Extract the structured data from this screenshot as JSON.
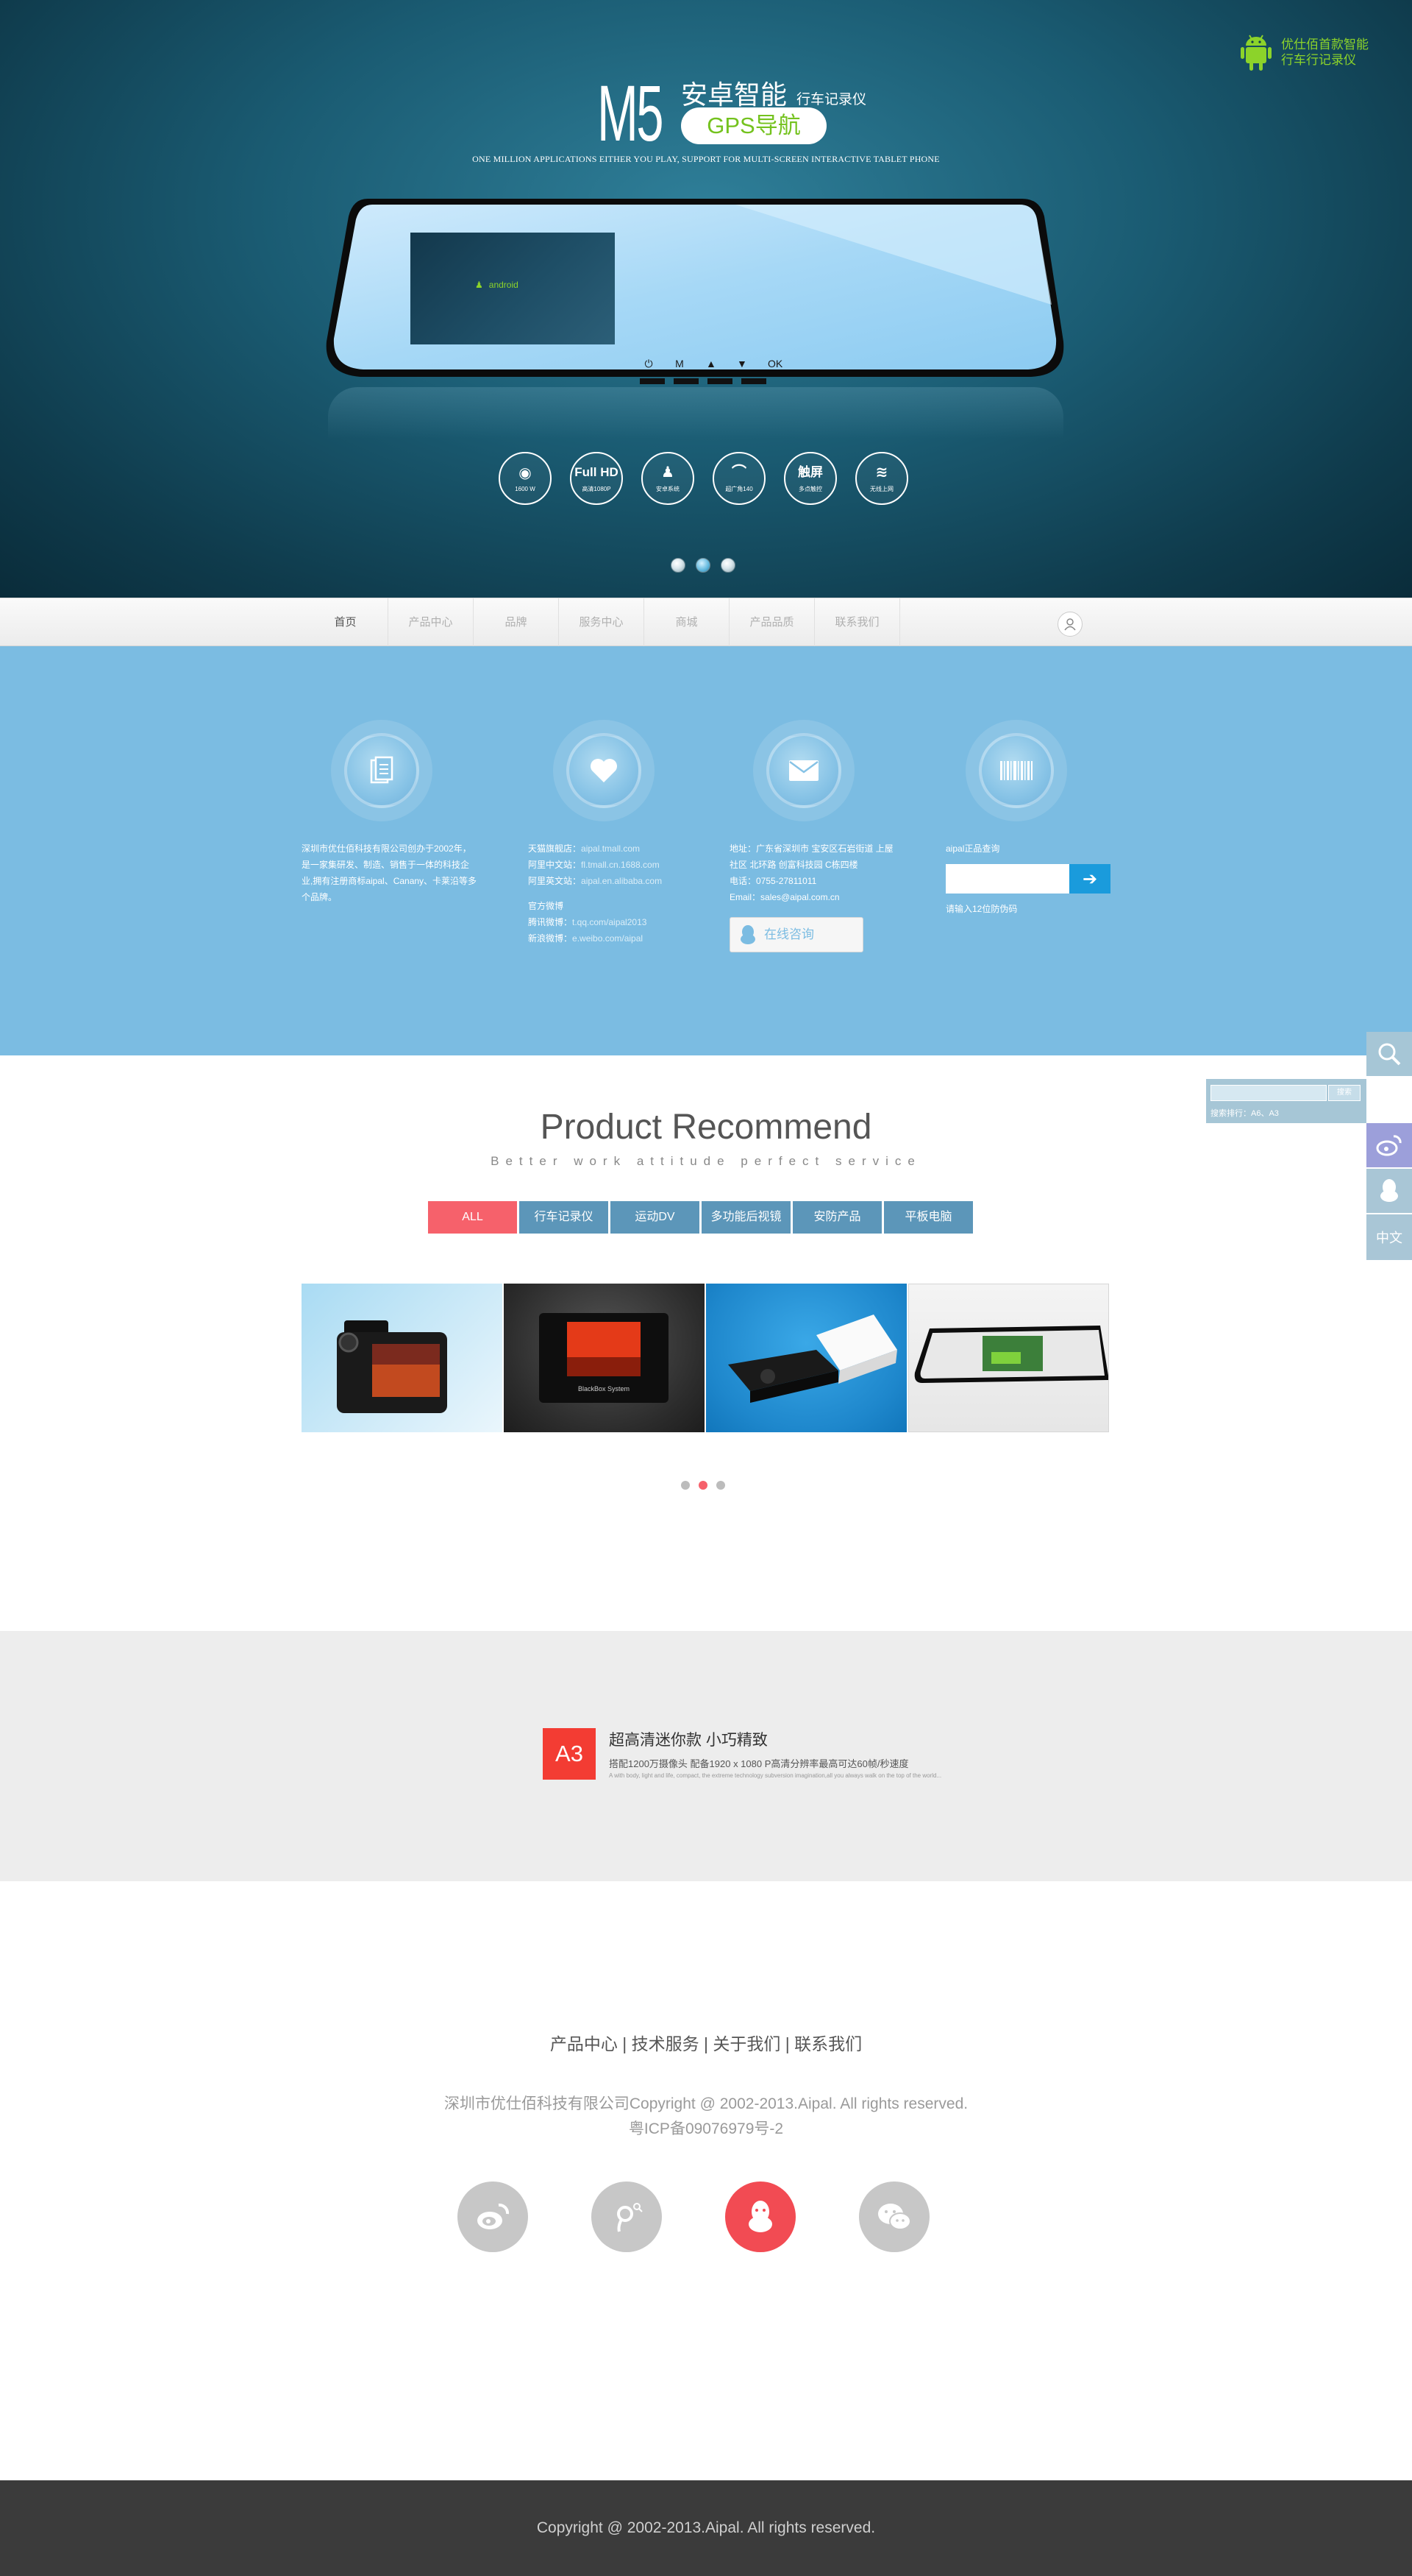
{
  "hero": {
    "brand_line1": "优仕佰首款智能",
    "brand_line2": "行车行记录仪",
    "model": "M5",
    "title_cn": "安卓智能",
    "title_sub": "行车记录仪",
    "gps_label": "GPS导航",
    "tagline": "ONE MILLION APPLICATIONS EITHER YOU PLAY, SUPPORT FOR MULTI-SCREEN INTERACTIVE TABLET PHONE",
    "screen_logo": "android",
    "mirror_buttons": [
      "⏻",
      "M",
      "▲",
      "▼",
      "OK"
    ],
    "features": [
      {
        "icon": "camera-icon",
        "glyph": "◉",
        "label": "1600 W"
      },
      {
        "icon": "full-hd-icon",
        "glyph": "Full HD",
        "label": "高清1080P"
      },
      {
        "icon": "android-icon",
        "glyph": "♟",
        "label": "安卓系统"
      },
      {
        "icon": "wide-angle-icon",
        "glyph": "⌒",
        "label": "超广角140"
      },
      {
        "icon": "touch-icon",
        "glyph": "触屏",
        "label": "多点触控"
      },
      {
        "icon": "wifi-icon",
        "glyph": "≋",
        "label": "无线上网"
      }
    ],
    "slide_count": 3,
    "active_slide": 1
  },
  "nav": {
    "items": [
      "首页",
      "产品中心",
      "品牌",
      "服务中心",
      "商城",
      "产品品质",
      "联系我们"
    ],
    "active_index": 0
  },
  "info": {
    "about": "深圳市优仕佰科技有限公司创办于2002年，是一家集研发、制造、销售于一体的科技企业,拥有注册商标aipal、Canany、卡莱沿等多个品牌。",
    "shop": {
      "tmall_label": "天猫旗舰店：",
      "tmall": "aipal.tmall.com",
      "cn_label": "阿里中文站：",
      "cn": "fl.tmall.cn.1688.com",
      "en_label": "阿里英文站：",
      "en": "aipal.en.alibaba.com",
      "weibo_title": "官方微博",
      "qq_weibo_label": "腾讯微博：",
      "qq_weibo": "t.qq.com/aipal2013",
      "sina_weibo_label": "新浪微博：",
      "sina_weibo": "e.weibo.com/aipal"
    },
    "contact": {
      "address_label": "地址：",
      "address": "广东省深圳市 宝安区石岩街道 上屋社区 北环路 创富科技园 C栋四楼",
      "phone_label": "电话：",
      "phone": "0755-27811011",
      "email_label": "Email：",
      "email": "sales@aipal.com.cn",
      "qq_button": "在线咨询"
    },
    "verify": {
      "title": "aipal正品查询",
      "hint": "请输入12位防伪码"
    }
  },
  "float": {
    "search_button": "搜索",
    "hot_search": "搜索排行：A6、A3",
    "lang": "中文"
  },
  "products": {
    "title": "Product Recommend",
    "subtitle": "Better work attitude perfect service",
    "tabs": [
      "ALL",
      "行车记录仪",
      "运动DV",
      "多功能后视镜",
      "安防产品",
      "平板电脑"
    ],
    "active_tab": 0,
    "p2_caption": "BlackBox System",
    "slide_count": 3,
    "active_slide": 1
  },
  "a3": {
    "badge": "A3",
    "title": "超高清迷你款  小巧精致",
    "desc": "搭配1200万摄像头 配备1920 x 1080 P高清分辨率最高可达60帧/秒速度",
    "fine": "A with body, light and life, compact, the extreme technology subversion imagination,all you always walk on the top of the world..."
  },
  "footer": {
    "links": "产品中心 | 技术服务 | 关于我们 | 联系我们",
    "copyright": "深圳市优仕佰科技有限公司Copyright @ 2002-2013.Aipal. All rights reserved.",
    "icp": "粤ICP备09076979号-2",
    "social": [
      "weibo-icon",
      "tencent-weibo-icon",
      "qq-icon",
      "wechat-icon"
    ],
    "active_social": 2,
    "bottom": "Copyright @ 2002-2013.Aipal. All rights reserved."
  },
  "colors": {
    "hero_dark": "#0f3b4c",
    "android_green": "#8cd32a",
    "info_blue": "#7bbce2",
    "accent_red": "#f6616b",
    "tab_blue": "#5c96b9",
    "badge_red": "#f33c33"
  }
}
